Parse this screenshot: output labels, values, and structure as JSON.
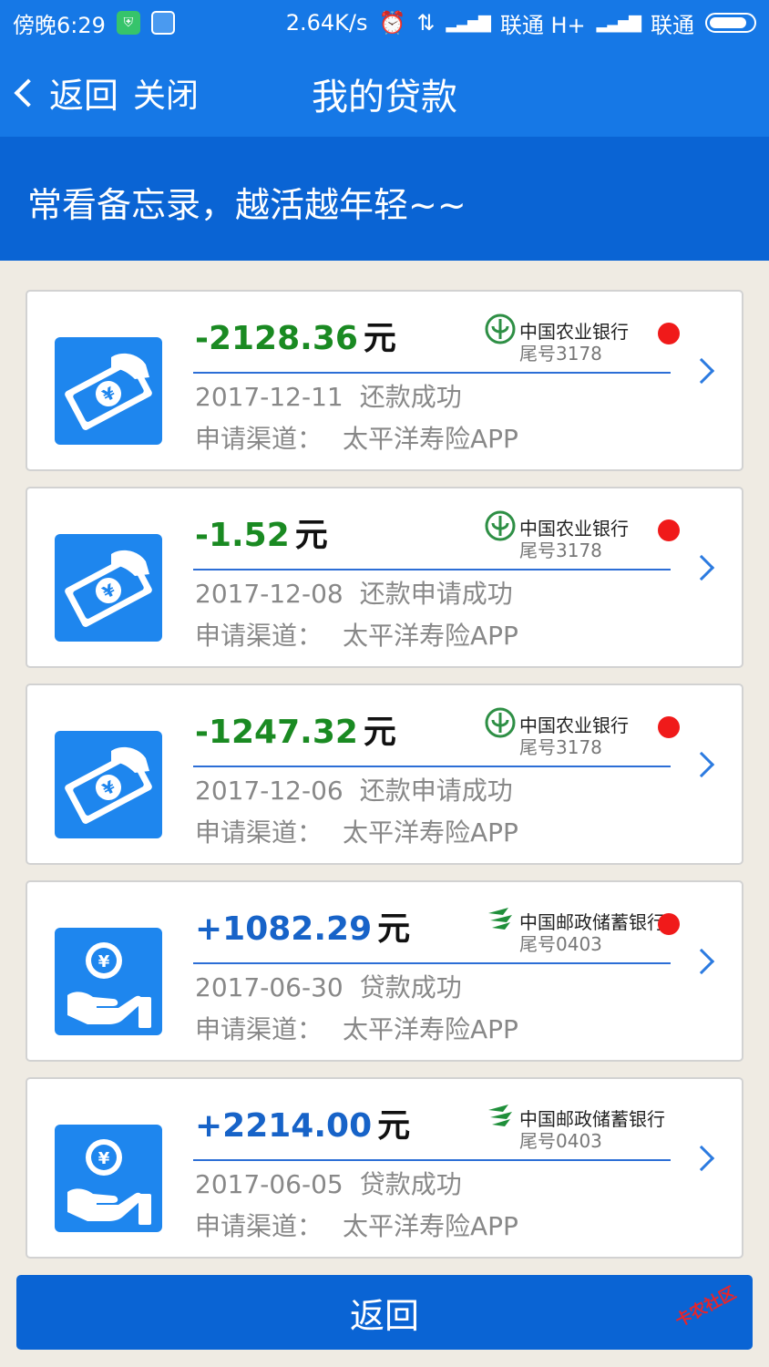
{
  "status_bar": {
    "time": "傍晚6:29",
    "speed": "2.64K/s",
    "carrier1": "联通 H+",
    "carrier2": "联通"
  },
  "nav": {
    "back_label": "返回",
    "close_label": "关闭",
    "title": "我的贷款"
  },
  "slogan": "常看备忘录，越活越年轻~~",
  "loans": [
    {
      "amount": "-2128.36",
      "unit": "元",
      "kind": "repay",
      "bank": "中国农业银行",
      "tail": "尾号3178",
      "date": "2017-12-11",
      "status": "还款成功",
      "channel_label": "申请渠道：",
      "channel": "太平洋寿险APP",
      "dot": true
    },
    {
      "amount": "-1.52",
      "unit": "元",
      "kind": "repay",
      "bank": "中国农业银行",
      "tail": "尾号3178",
      "date": "2017-12-08",
      "status": "还款申请成功",
      "channel_label": "申请渠道：",
      "channel": "太平洋寿险APP",
      "dot": true
    },
    {
      "amount": "-1247.32",
      "unit": "元",
      "kind": "repay",
      "bank": "中国农业银行",
      "tail": "尾号3178",
      "date": "2017-12-06",
      "status": "还款申请成功",
      "channel_label": "申请渠道：",
      "channel": "太平洋寿险APP",
      "dot": true
    },
    {
      "amount": "+1082.29",
      "unit": "元",
      "kind": "loan",
      "bank": "中国邮政储蓄银行",
      "tail": "尾号0403",
      "date": "2017-06-30",
      "status": "贷款成功",
      "channel_label": "申请渠道：",
      "channel": "太平洋寿险APP",
      "dot": true
    },
    {
      "amount": "+2214.00",
      "unit": "元",
      "kind": "loan",
      "bank": "中国邮政储蓄银行",
      "tail": "尾号0403",
      "date": "2017-06-05",
      "status": "贷款成功",
      "channel_label": "申请渠道：",
      "channel": "太平洋寿险APP",
      "dot": false
    }
  ],
  "bottom_button": "返回",
  "watermark": "卡农社区",
  "colors": {
    "primary": "#1678e6",
    "banner": "#0a64d4",
    "negative_amount": "#1a8a22",
    "positive_amount": "#1763c8",
    "dot": "#f01a1a"
  }
}
